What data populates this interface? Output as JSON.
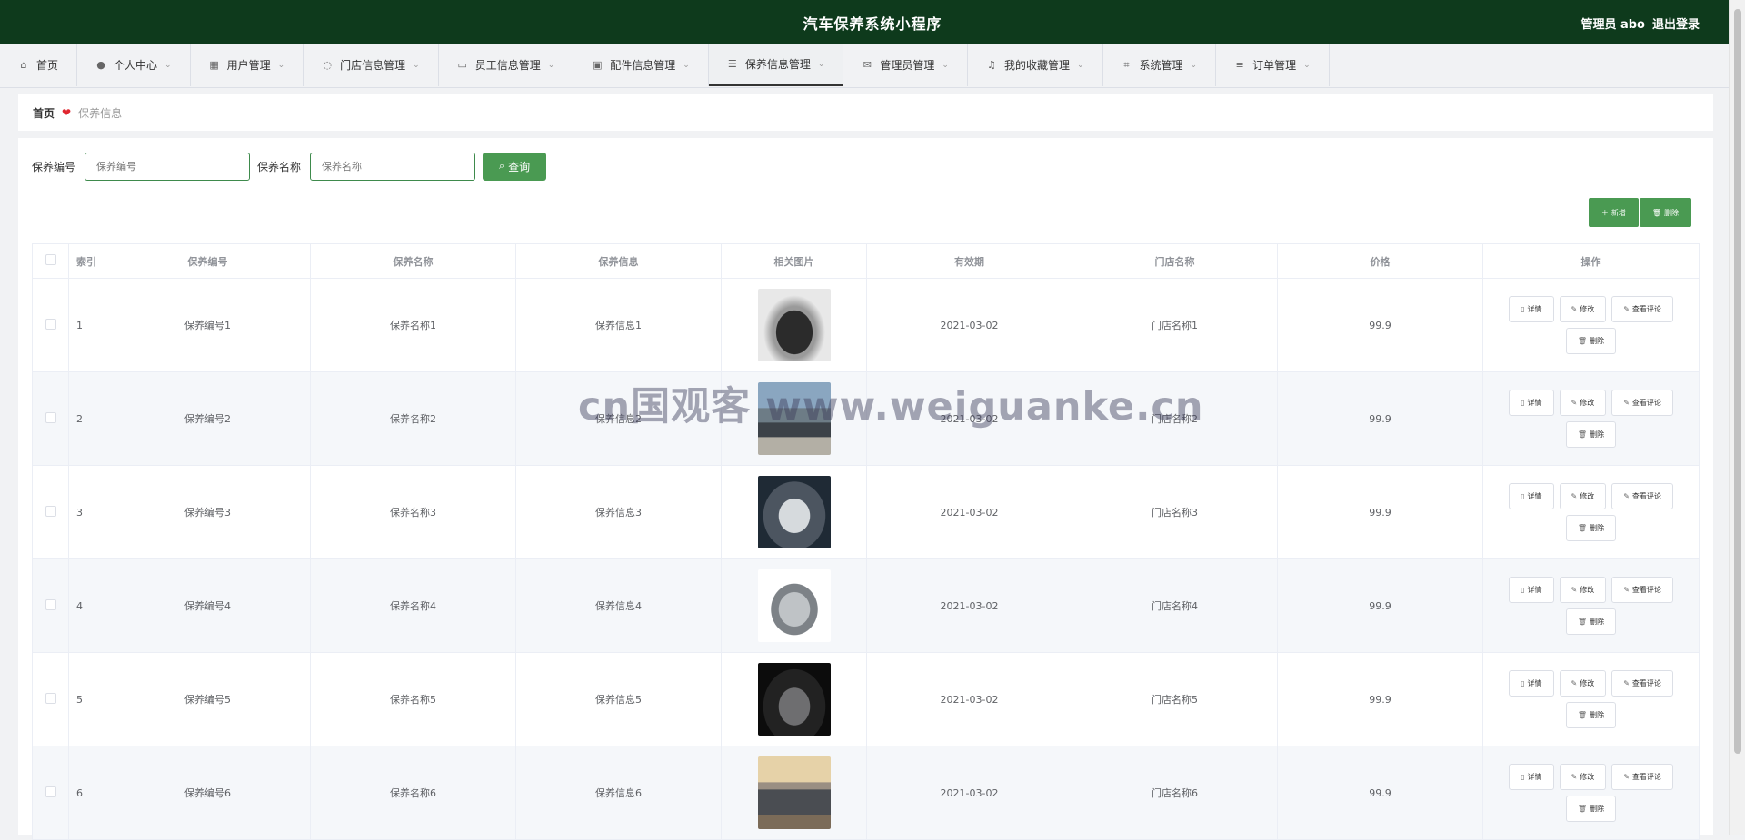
{
  "header": {
    "title": "汽车保养系统小程序",
    "user": "管理员 abo",
    "logout": "退出登录"
  },
  "menu": [
    {
      "label": "首页",
      "icon": "home-icon",
      "glyph": "⌂",
      "has_dropdown": false
    },
    {
      "label": "个人中心",
      "icon": "user-icon",
      "glyph": "●",
      "has_dropdown": true
    },
    {
      "label": "用户管理",
      "icon": "grid-icon",
      "glyph": "▦",
      "has_dropdown": true
    },
    {
      "label": "门店信息管理",
      "icon": "power-icon",
      "glyph": "◌",
      "has_dropdown": true
    },
    {
      "label": "员工信息管理",
      "icon": "monitor-icon",
      "glyph": "▭",
      "has_dropdown": true
    },
    {
      "label": "配件信息管理",
      "icon": "briefcase-icon",
      "glyph": "▣",
      "has_dropdown": true
    },
    {
      "label": "保养信息管理",
      "icon": "sliders-icon",
      "glyph": "☰",
      "has_dropdown": true,
      "active": true
    },
    {
      "label": "管理员管理",
      "icon": "mail-icon",
      "glyph": "✉",
      "has_dropdown": true
    },
    {
      "label": "我的收藏管理",
      "icon": "bell-icon",
      "glyph": "♫",
      "has_dropdown": true
    },
    {
      "label": "系统管理",
      "icon": "crop-icon",
      "glyph": "⌗",
      "has_dropdown": true
    },
    {
      "label": "订单管理",
      "icon": "list-icon",
      "glyph": "≡",
      "has_dropdown": true
    }
  ],
  "breadcrumb": {
    "home": "首页",
    "current": "保养信息"
  },
  "search": {
    "field1_label": "保养编号",
    "field1_placeholder": "保养编号",
    "field2_label": "保养名称",
    "field2_placeholder": "保养名称",
    "query_label": "查询"
  },
  "toolbar": {
    "add_label": "新增",
    "delete_label": "删除"
  },
  "table": {
    "columns": [
      "索引",
      "保养编号",
      "保养名称",
      "保养信息",
      "相关图片",
      "有效期",
      "门店名称",
      "价格",
      "操作"
    ],
    "rows": [
      {
        "index": "1",
        "code": "保养编号1",
        "name": "保养名称1",
        "info": "保养信息1",
        "date": "2021-03-02",
        "store": "门店名称1",
        "price": "99.9",
        "img": "car-black-sport"
      },
      {
        "index": "2",
        "code": "保养编号2",
        "name": "保养名称2",
        "info": "保养信息2",
        "date": "2021-03-02",
        "store": "门店名称2",
        "price": "99.9",
        "img": "car-city-street"
      },
      {
        "index": "3",
        "code": "保养编号3",
        "name": "保养名称3",
        "info": "保养信息3",
        "date": "2021-03-02",
        "store": "门店名称3",
        "price": "99.9",
        "img": "car-silver-suv"
      },
      {
        "index": "4",
        "code": "保养编号4",
        "name": "保养名称4",
        "info": "保养信息4",
        "date": "2021-03-02",
        "store": "门店名称4",
        "price": "99.9",
        "img": "car-white-suv"
      },
      {
        "index": "5",
        "code": "保养编号5",
        "name": "保养名称5",
        "info": "保养信息5",
        "date": "2021-03-02",
        "store": "门店名称5",
        "price": "99.9",
        "img": "car-dark-showroom"
      },
      {
        "index": "6",
        "code": "保养编号6",
        "name": "保养名称6",
        "info": "保养信息6",
        "date": "2021-03-02",
        "store": "门店名称6",
        "price": "99.9",
        "img": "car-grey-muscle"
      }
    ],
    "row_actions": {
      "detail": "详情",
      "edit": "修改",
      "comments": "查看评论",
      "delete": "删除"
    }
  },
  "watermark": "cn国观客 www.weiguanke.cn",
  "colors": {
    "header_bg": "#0e3a1c",
    "accent": "#4a9a52",
    "heart": "#e0262f"
  }
}
